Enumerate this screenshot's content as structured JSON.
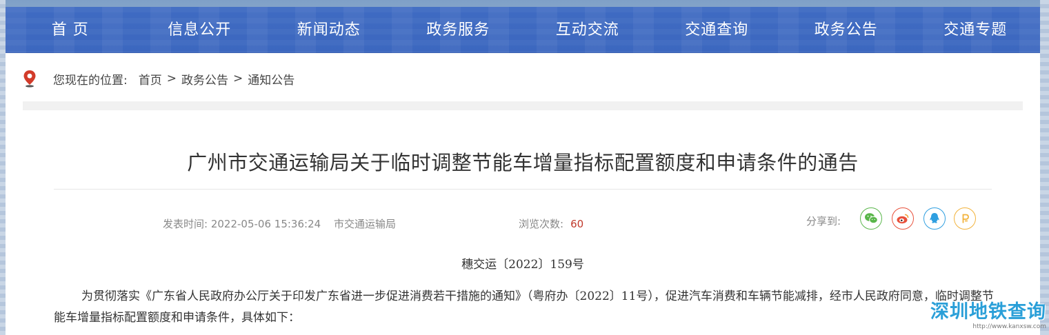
{
  "nav": {
    "items": [
      "首 页",
      "信息公开",
      "新闻动态",
      "政务服务",
      "互动交流",
      "交通查询",
      "政务公告",
      "交通专题"
    ]
  },
  "breadcrumb": {
    "prefix": "您现在的位置:",
    "items": [
      "首页",
      "政务公告",
      "通知公告"
    ],
    "separator": ">"
  },
  "article": {
    "title": "广州市交通运输局关于临时调整节能车增量指标配置额度和申请条件的通告",
    "publish_label": "发表时间:",
    "publish_time": "2022-05-06 15:36:24",
    "publisher": "市交通运输局",
    "views_label": "浏览次数:",
    "views_count": "60",
    "share_label": "分享到:",
    "doc_number": "穗交运〔2022〕159号",
    "paragraph": "为贯彻落实《广东省人民政府办公厅关于印发广东省进一步促进消费若干措施的通知》（粤府办〔2022〕11号），促进汽车消费和车辆节能减排，经市人民政府同意，临时调整节能车增量指标配置额度和申请条件，具体如下："
  },
  "share_icons": [
    "wechat-icon",
    "weibo-icon",
    "qq-icon",
    "qzone-icon"
  ],
  "colors": {
    "nav_bg": "#3c67bf",
    "wechat": "#59b64a",
    "weibo": "#e8513c",
    "qq": "#2f9fe0",
    "qzone": "#f2b23a",
    "views_count": "#c0392b",
    "watermark": "#2a9fd8"
  },
  "watermark": {
    "main": "深圳地铁查询",
    "sub": "http://www.kanxsw.com"
  }
}
